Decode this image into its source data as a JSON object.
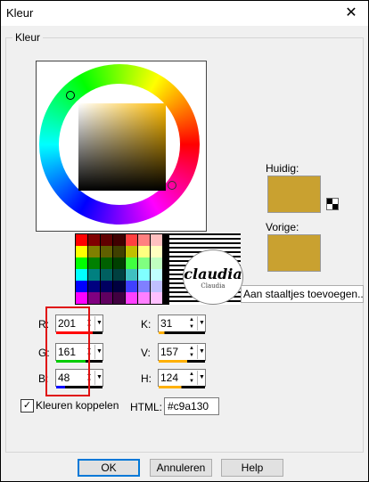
{
  "window": {
    "title": "Kleur",
    "close_glyph": "✕"
  },
  "group": {
    "label": "Kleur"
  },
  "current_label": "Huidig:",
  "previous_label": "Vorige:",
  "current_color": "#c9a130",
  "previous_color": "#c9a130",
  "watermark": {
    "name": "claudia",
    "sub": "Claudia"
  },
  "add_button_label": "Aan staaltjes toevoegen...",
  "palette": [
    "#ff0000",
    "#800000",
    "#600000",
    "#400000",
    "#ff4040",
    "#ff8080",
    "#ffc0c0",
    "#ffff00",
    "#808000",
    "#606000",
    "#404000",
    "#c0c000",
    "#ffff80",
    "#ffffc0",
    "#00ff00",
    "#008000",
    "#006000",
    "#004000",
    "#40ff40",
    "#80ff80",
    "#c0ffc0",
    "#00ffff",
    "#008080",
    "#006060",
    "#004040",
    "#40c0c0",
    "#80ffff",
    "#c0ffff",
    "#0000ff",
    "#000080",
    "#000060",
    "#000040",
    "#4040ff",
    "#8080ff",
    "#c0c0ff",
    "#ff00ff",
    "#800080",
    "#600060",
    "#400040",
    "#ff40ff",
    "#ff80ff",
    "#ffc0ff"
  ],
  "rgb": [
    {
      "label": "R:",
      "value": "201",
      "bar": "#ff0000"
    },
    {
      "label": "G:",
      "value": "161",
      "bar": "#00cc00"
    },
    {
      "label": "B:",
      "value": "48",
      "bar": "#0000ff"
    }
  ],
  "hsv": [
    {
      "label": "K:",
      "value": "31",
      "bar": "#ffb000"
    },
    {
      "label": "V:",
      "value": "157",
      "bar": "#ffb000"
    },
    {
      "label": "H:",
      "value": "124",
      "bar": "#ffb000"
    }
  ],
  "spin_glyphs": {
    "up": "▲",
    "down": "▼",
    "drop": "▼"
  },
  "link_colors": {
    "label": "Kleuren koppelen",
    "checked": "✓"
  },
  "html": {
    "label": "HTML:",
    "value": "#c9a130"
  },
  "buttons": {
    "ok": "OK",
    "cancel": "Annuleren",
    "help": "Help"
  }
}
